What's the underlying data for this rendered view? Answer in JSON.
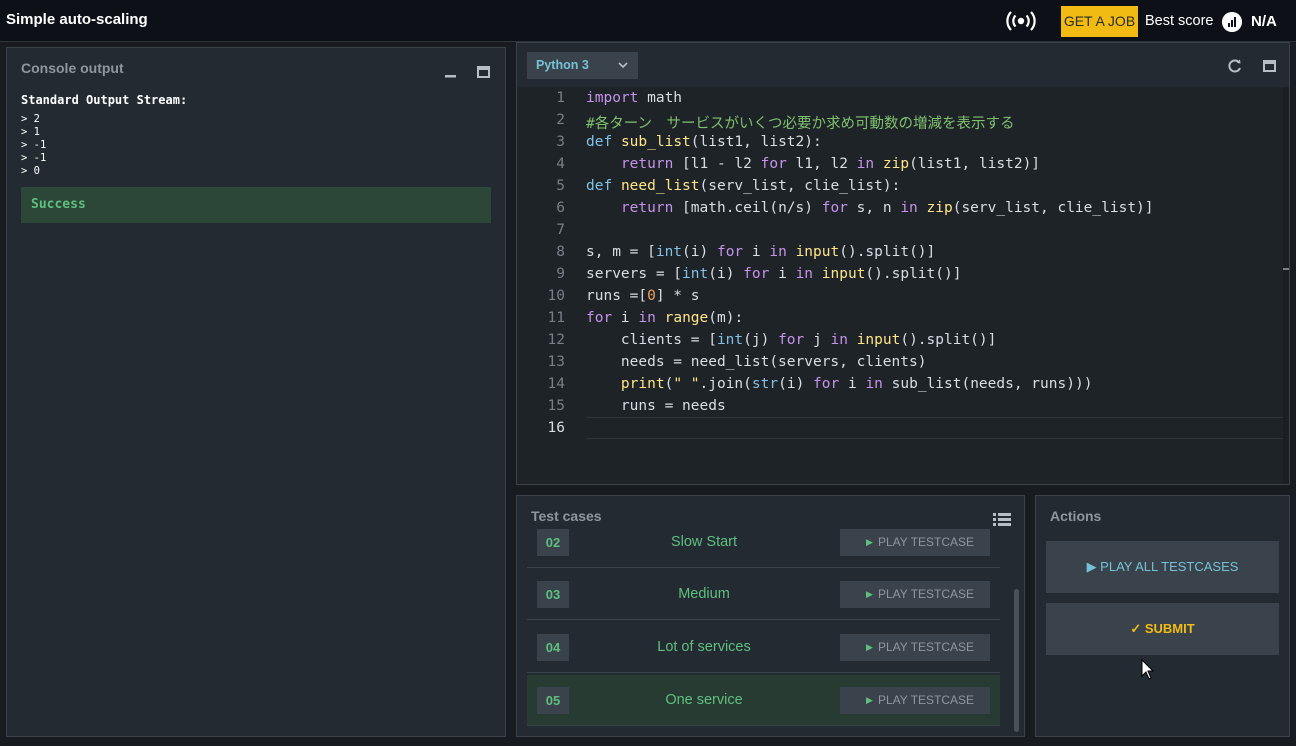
{
  "header": {
    "title": "Simple auto-scaling",
    "job_button": "GET A JOB",
    "best_score_label": "Best score",
    "best_score_value": "N/A"
  },
  "console": {
    "title": "Console output",
    "stream_label": "Standard Output Stream:",
    "lines": [
      "> 2",
      "> 1",
      "> -1",
      "> -1",
      "> 0"
    ],
    "status": "Success"
  },
  "editor": {
    "language": "Python 3",
    "line_numbers": [
      "1",
      "2",
      "3",
      "4",
      "5",
      "6",
      "7",
      "8",
      "9",
      "10",
      "11",
      "12",
      "13",
      "14",
      "15",
      "16"
    ]
  },
  "tests": {
    "title": "Test cases",
    "play_label": "PLAY TESTCASE",
    "rows": [
      {
        "num": "02",
        "name": "Slow Start"
      },
      {
        "num": "03",
        "name": "Medium"
      },
      {
        "num": "04",
        "name": "Lot of services"
      },
      {
        "num": "05",
        "name": "One service"
      }
    ]
  },
  "actions": {
    "title": "Actions",
    "play_all": "PLAY ALL TESTCASES",
    "submit": "SUBMIT"
  },
  "colors": {
    "accent_yellow": "#f2bb13",
    "success_green": "#5ec07e",
    "link_blue": "#75c2d6"
  }
}
